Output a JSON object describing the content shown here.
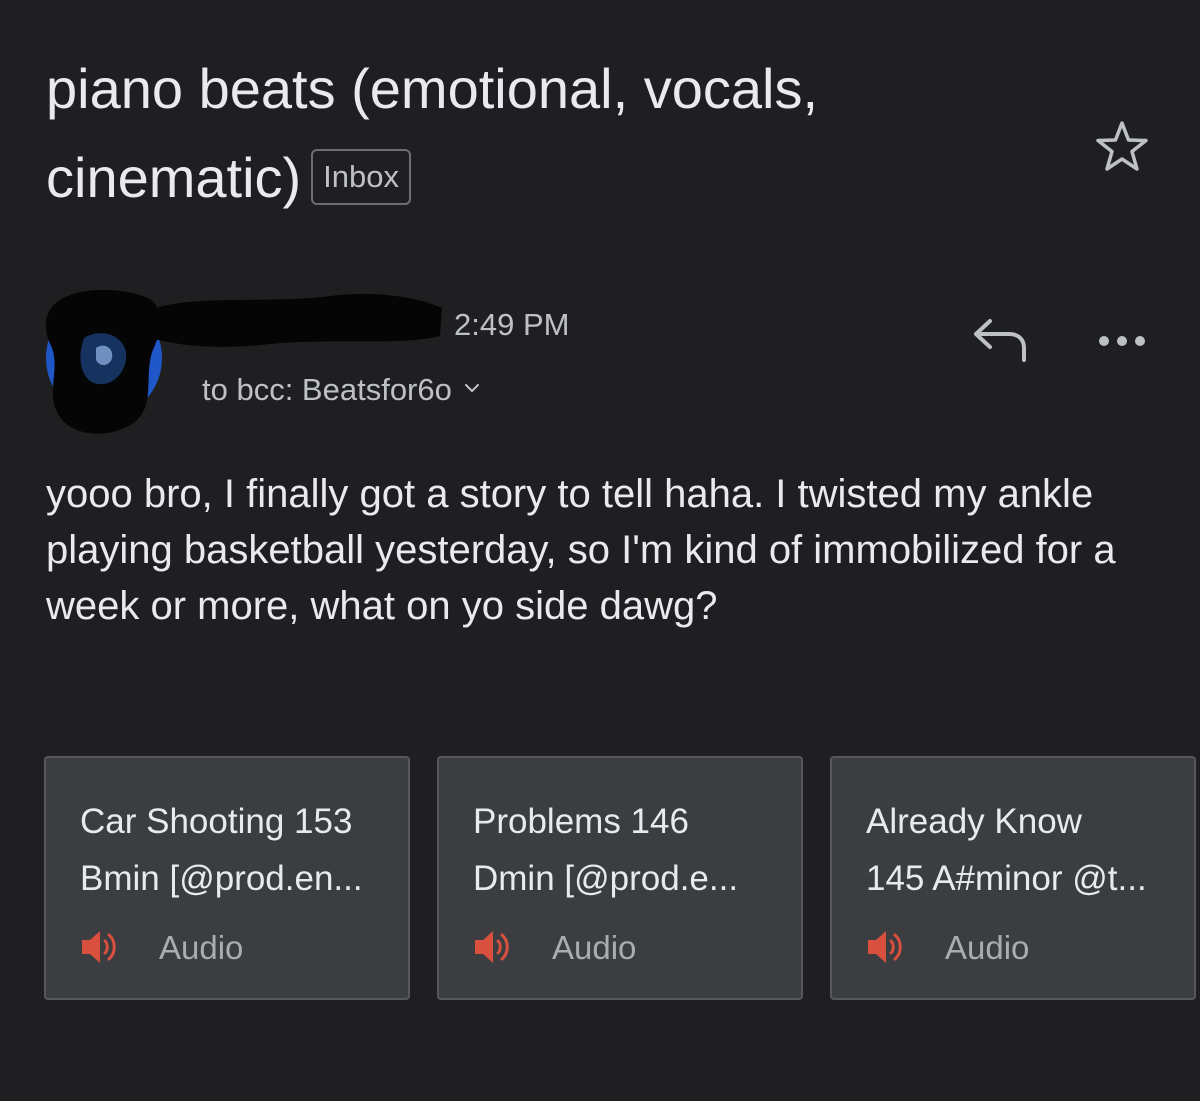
{
  "message": {
    "subject": "piano beats (emotional, vocals, cinematic)",
    "label": "Inbox",
    "time": "2:49 PM",
    "recipients": "to bcc: Beatsfor6o",
    "body": "yooo bro, I finally got a story to tell haha. I twisted my ankle playing basketball yesterday, so I'm kind of immobilized for a week or more, what on yo side dawg?"
  },
  "icons": {
    "star": "star-outline-icon",
    "reply": "reply-icon",
    "more": "more-horizontal-icon",
    "expand": "chevron-down-icon",
    "audio": "speaker-icon"
  },
  "colors": {
    "background": "#1f1f21",
    "card": "#3b3d40",
    "audio_icon": "#d9503f"
  },
  "attachments": [
    {
      "line1": "Car Shooting 153",
      "line2": "Bmin [@prod.en...",
      "type": "Audio"
    },
    {
      "line1": "Problems 146",
      "line2": "Dmin [@prod.e...",
      "type": "Audio"
    },
    {
      "line1": "Already Know",
      "line2": "145 A#minor @t...",
      "type": "Audio"
    }
  ]
}
